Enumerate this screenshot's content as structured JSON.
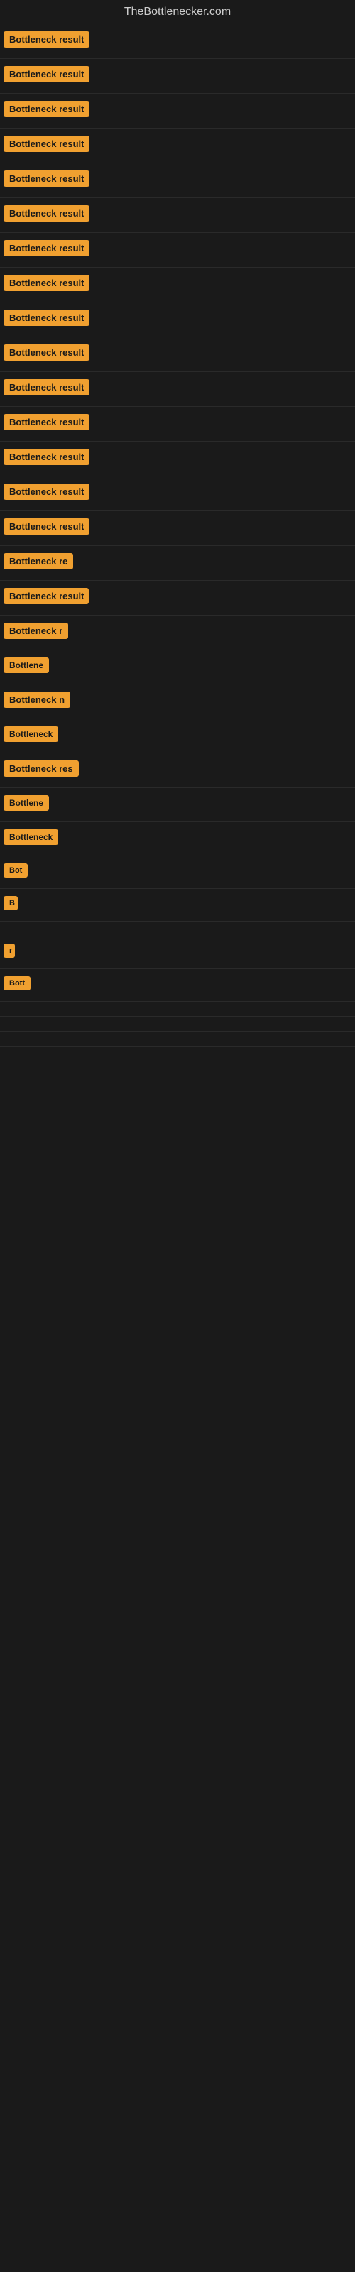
{
  "site": {
    "title": "TheBottlenecker.com"
  },
  "results": [
    {
      "id": 1,
      "label": "Bottleneck result",
      "width": 145
    },
    {
      "id": 2,
      "label": "Bottleneck result",
      "width": 145
    },
    {
      "id": 3,
      "label": "Bottleneck result",
      "width": 145
    },
    {
      "id": 4,
      "label": "Bottleneck result",
      "width": 145
    },
    {
      "id": 5,
      "label": "Bottleneck result",
      "width": 145
    },
    {
      "id": 6,
      "label": "Bottleneck result",
      "width": 145
    },
    {
      "id": 7,
      "label": "Bottleneck result",
      "width": 145
    },
    {
      "id": 8,
      "label": "Bottleneck result",
      "width": 145
    },
    {
      "id": 9,
      "label": "Bottleneck result",
      "width": 145
    },
    {
      "id": 10,
      "label": "Bottleneck result",
      "width": 145
    },
    {
      "id": 11,
      "label": "Bottleneck result",
      "width": 145
    },
    {
      "id": 12,
      "label": "Bottleneck result",
      "width": 130
    },
    {
      "id": 13,
      "label": "Bottleneck result",
      "width": 130
    },
    {
      "id": 14,
      "label": "Bottleneck result",
      "width": 130
    },
    {
      "id": 15,
      "label": "Bottleneck result",
      "width": 130
    },
    {
      "id": 16,
      "label": "Bottleneck re",
      "width": 105
    },
    {
      "id": 17,
      "label": "Bottleneck result",
      "width": 120
    },
    {
      "id": 18,
      "label": "Bottleneck r",
      "width": 95
    },
    {
      "id": 19,
      "label": "Bottlene",
      "width": 80
    },
    {
      "id": 20,
      "label": "Bottleneck n",
      "width": 100
    },
    {
      "id": 21,
      "label": "Bottleneck",
      "width": 85
    },
    {
      "id": 22,
      "label": "Bottleneck res",
      "width": 110
    },
    {
      "id": 23,
      "label": "Bottlene",
      "width": 75
    },
    {
      "id": 24,
      "label": "Bottleneck",
      "width": 80
    },
    {
      "id": 25,
      "label": "Bot",
      "width": 40
    },
    {
      "id": 26,
      "label": "B",
      "width": 20
    },
    {
      "id": 27,
      "label": "",
      "width": 0
    },
    {
      "id": 28,
      "label": "r",
      "width": 12
    },
    {
      "id": 29,
      "label": "Bott",
      "width": 38
    },
    {
      "id": 30,
      "label": "",
      "width": 0
    },
    {
      "id": 31,
      "label": "",
      "width": 0
    },
    {
      "id": 32,
      "label": "",
      "width": 0
    },
    {
      "id": 33,
      "label": "",
      "width": 0
    },
    {
      "id": 34,
      "label": "",
      "width": 0
    }
  ]
}
